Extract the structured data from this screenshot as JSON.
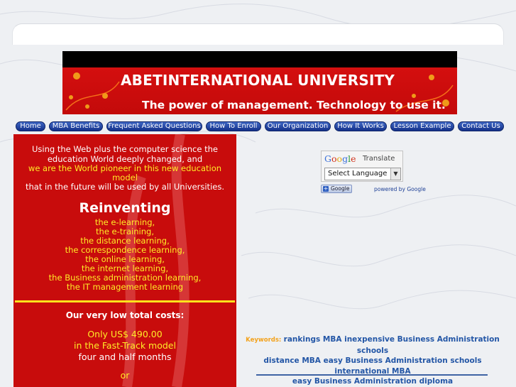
{
  "banner": {
    "title": "ABETINTERNATIONAL UNIVERSITY",
    "subtitle": "The power of management. Technology to use it."
  },
  "nav": {
    "items": [
      {
        "label": "Home"
      },
      {
        "label": "MBA Benefits"
      },
      {
        "label": "Frequent Asked Questions"
      },
      {
        "label": "How To Enroll"
      },
      {
        "label": "Our Organization"
      },
      {
        "label": "How It Works"
      },
      {
        "label": "Lesson Example"
      },
      {
        "label": "Contact Us"
      }
    ]
  },
  "panel": {
    "intro_line1": "Using the Web plus the computer science  the",
    "intro_line2": "education World deeply changed, and",
    "intro_line3": "we are the World pioneer in this new education",
    "intro_line4": "model",
    "intro_line5": "that in the future will be used by all Universities.",
    "heading": "Reinventing",
    "list": [
      "the e-learning,",
      "the e-training,",
      "the distance learning,",
      "the correspondence learning,",
      "the online learning,",
      "the internet learning,",
      "the Business administration learning,",
      "the IT management learning"
    ],
    "costs_heading": "Our very low total costs:",
    "price": "Only US$ 490.00",
    "model": "in the Fast-Track model",
    "duration": "four and half months",
    "or": "or"
  },
  "translate": {
    "logo": "Google",
    "label": "Translate",
    "select_value": "Select Language",
    "button_label": "Google",
    "powered_by": "powered by Google"
  },
  "keywords": {
    "label": "Keywords:",
    "text": "rankings MBA inexpensive Business Administration schools distance MBA easy Business Administration schools international MBA easy Business Administration diploma",
    "line1": "rankings MBA inexpensive Business Administration schools",
    "line2": "distance MBA easy Business Administration schools international MBA",
    "line3": "easy Business Administration diploma"
  },
  "colors": {
    "panel_red": "#c80c0c",
    "text_yellow": "#ffec27",
    "nav_blue": "#1c3c98",
    "keyword_blue": "#2356a6",
    "keyword_label_orange": "#f3a21c"
  }
}
